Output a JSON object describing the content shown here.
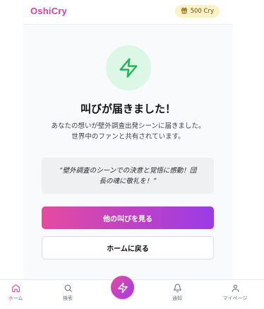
{
  "header": {
    "logo": "OshiCry",
    "coin_balance": "500 Cry",
    "coin_icon": "gift-icon"
  },
  "success": {
    "icon": "lightning-icon",
    "title": "叫びが届きました！",
    "desc_line1": "あなたの想いが壁外調査出発シーンに届きました。",
    "desc_line2": "世界中のファンと共有されています。",
    "quote_line1": "“壁外調査のシーンでの決意と覚悟に感動！団",
    "quote_line2": "長の魂に敬礼を！”"
  },
  "actions": {
    "see_others": "他の叫びを見る",
    "back_home": "ホームに戻る"
  },
  "nav": {
    "home": "ホーム",
    "search": "検索",
    "notifications": "通知",
    "mypage": "マイページ"
  },
  "colors": {
    "brand": "#d63fa5",
    "gradient_start": "#e64aa0",
    "gradient_end": "#9b3be6",
    "success_bg": "#dcf7e6",
    "success_icon": "#22b45a",
    "coin_bg": "#fbf1c7"
  }
}
